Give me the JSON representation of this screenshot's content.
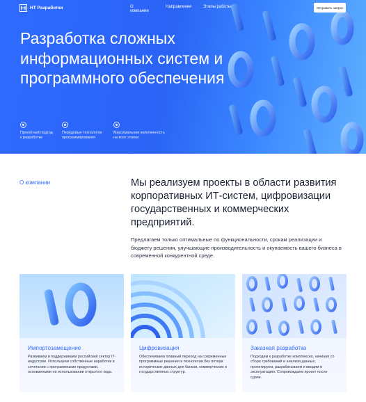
{
  "header": {
    "logo_text": "НТ Разработки",
    "nav": [
      "О компании",
      "Направления",
      "Этапы работы"
    ],
    "cta_label": "Отправить запрос"
  },
  "hero": {
    "title": "Разработка сложных информационных систем и программного обеспечения",
    "features": [
      "Проектный подход\nк разработке",
      "Передовые технологии\nпрограммирования",
      "Максимальная включенность\nна всех этапах"
    ]
  },
  "about": {
    "label": "О компании",
    "lead": "Мы реализуем проекты в области развития корпоративных ИТ-систем, цифровизации государственных и коммерческих предприятий.",
    "text": "Предлагаем только оптимальные по функциональности, срокам реализации и бюджету решения, улучшающие производительность и окупаемость вашего бизнеса в современной конкурентной среде."
  },
  "cards": [
    {
      "title": "Импортозамещение",
      "description": "Развиваем и поддерживаем российский сектор IT-индустрии. Используем собственные наработки в сочетании с программными продуктами, основанными на использовании открытого кода."
    },
    {
      "title": "Цифровизация",
      "description": "Обеспечиваем плавный переход на современные программные решения и технологии без потери исторических данных для банков, коммерческих и государственных структур."
    },
    {
      "title": "Заказная разработка",
      "description": "Подходим к разработке комплексно, начиная со сбора требований и анализа данных, проектируем, разрабатываем и вводим в эксплуатацию. Сопровождаем проект после сдачи."
    }
  ],
  "colors": {
    "accent": "#2f6bff",
    "hero_start": "#2f6bff",
    "hero_end": "#5fb0ff",
    "card_bg": "#eef3ff"
  }
}
